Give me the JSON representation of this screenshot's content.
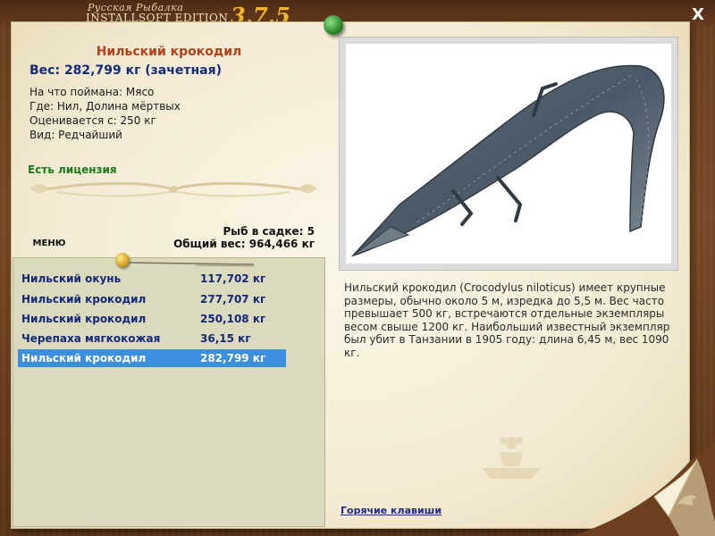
{
  "app": {
    "logo_sub": "Русская Рыбалка",
    "logo_main": "INSTALLSOFT EDITION",
    "version": "3.7.5",
    "close_label": "X"
  },
  "fish": {
    "title": "Нильский крокодил",
    "weight_line": "Вес: 282,799 кг (зачетная)",
    "bait": "На что поймана: Мясо",
    "location": "Где: Нил, Долина мёртвых",
    "valued": "Оценивается с: 250 кг",
    "rarity": "Вид: Редчайший",
    "license": "Есть лицензия"
  },
  "keepnet": {
    "count_line": "Рыб в садке: 5",
    "total_line": "Общий вес: 964,466 кг",
    "menu_label": "МЕНЮ",
    "rows": [
      {
        "name": "Нильский окунь",
        "weight": "117,702 кг"
      },
      {
        "name": "Нильский крокодил",
        "weight": "277,707 кг"
      },
      {
        "name": "Нильский крокодил",
        "weight": "250,108 кг"
      },
      {
        "name": "Черепаха мягкокожая",
        "weight": "36,15 кг"
      },
      {
        "name": "Нильский крокодил",
        "weight": "282,799 кг"
      }
    ],
    "selected_index": 4
  },
  "description": "Нильский крокодил (Crocodylus niloticus) имеет крупные размеры, обычно около 5 м, изредка до 5,5 м. Вес часто превышает 500 кг, встречаются отдельные экземпляры весом свыше 1200 кг. Наибольший известный экземпляр был убит в Танзании в 1905 году: длина 6,45 м, вес 1090 кг.",
  "hotkeys_label": "Горячие клавиши",
  "colors": {
    "title_accent": "#b0421c",
    "weight_text": "#142a7a",
    "license_text": "#1f7a1f",
    "selection": "#3c8ee0",
    "version": "#f2b630"
  },
  "icons": [
    "pin-icon",
    "close-icon",
    "boat-icon"
  ]
}
